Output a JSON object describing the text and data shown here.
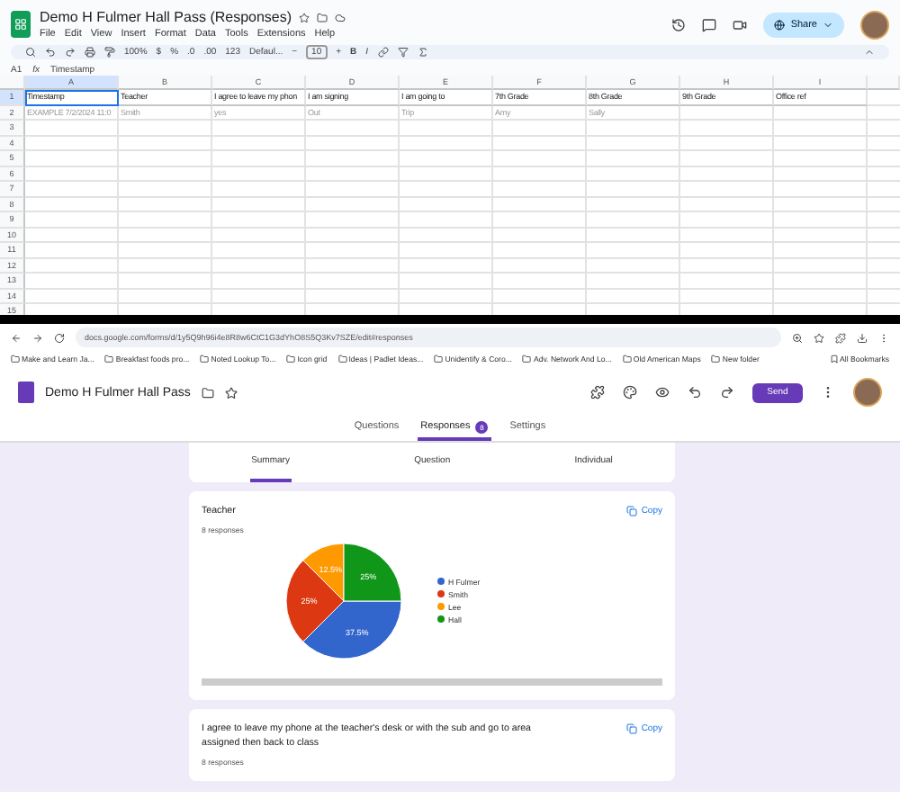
{
  "sheets": {
    "title": "Demo H Fulmer Hall Pass (Responses)",
    "menu": [
      "File",
      "Edit",
      "View",
      "Insert",
      "Format",
      "Data",
      "Tools",
      "Extensions",
      "Help"
    ],
    "share": "Share",
    "toolbar": {
      "zoom": "100%",
      "currency": "$",
      "percent": "%",
      "dec_less": ".0",
      "dec_more": ".00",
      "number_format": "123",
      "font": "Defaul...",
      "minus": "−",
      "font_size": "10",
      "plus": "+",
      "bold": "B",
      "italic": "I"
    },
    "name_box": "A1",
    "fx": "fx",
    "formula": "Timestamp",
    "columns": [
      {
        "label": "A",
        "selected": true
      },
      {
        "label": "B",
        "selected": false
      },
      {
        "label": "C",
        "selected": false
      },
      {
        "label": "D",
        "selected": false
      },
      {
        "label": "E",
        "selected": false
      },
      {
        "label": "F",
        "selected": false
      },
      {
        "label": "G",
        "selected": false
      },
      {
        "label": "H",
        "selected": false
      },
      {
        "label": "I",
        "selected": false
      }
    ],
    "rows": [
      {
        "num": "1",
        "selected": true,
        "cells": [
          "Timestamp",
          "Teacher",
          "I agree to leave my phon",
          "I am signing",
          "I am going to",
          "7th Grade",
          "8th Grade",
          "9th Grade",
          "Office ref"
        ]
      },
      {
        "num": "2",
        "selected": false,
        "cells": [
          "EXAMPLE  7/2/2024 11:0",
          "Smith",
          "yes",
          "Out",
          "Trip",
          "Amy",
          "Sally",
          "",
          ""
        ]
      },
      {
        "num": "3",
        "selected": false,
        "cells": []
      },
      {
        "num": "4",
        "selected": false,
        "cells": []
      },
      {
        "num": "5",
        "selected": false,
        "cells": []
      },
      {
        "num": "6",
        "selected": false,
        "cells": []
      },
      {
        "num": "7",
        "selected": false,
        "cells": []
      },
      {
        "num": "8",
        "selected": false,
        "cells": []
      },
      {
        "num": "9",
        "selected": false,
        "cells": []
      },
      {
        "num": "10",
        "selected": false,
        "cells": []
      },
      {
        "num": "11",
        "selected": false,
        "cells": []
      },
      {
        "num": "12",
        "selected": false,
        "cells": []
      },
      {
        "num": "13",
        "selected": false,
        "cells": []
      },
      {
        "num": "14",
        "selected": false,
        "cells": []
      },
      {
        "num": "15",
        "selected": false,
        "cells": []
      }
    ]
  },
  "browser": {
    "url": "docs.google.com/forms/d/1y5Q9h96i4e8R8w6CtC1G3dYhO8S5Q3Kv7SZE/edit#responses",
    "bookmarks": [
      "Make and Learn Ja...",
      "Breakfast foods pro...",
      "Noted Lookup To...",
      "Icon grid",
      "Ideas | Padlet Ideas...",
      "Unidentify & Coro...",
      "Adv. Network And Lo...",
      "Old American Maps",
      "New folder"
    ],
    "all_bookmarks": "All Bookmarks"
  },
  "form": {
    "title": "Demo H Fulmer Hall Pass",
    "send": "Send",
    "tabs": [
      {
        "label": "Questions",
        "selected": false
      },
      {
        "label": "Responses",
        "selected": true,
        "badge": "8"
      },
      {
        "label": "Settings",
        "selected": false
      }
    ],
    "subtabs": [
      {
        "label": "Summary",
        "selected": true
      },
      {
        "label": "Question",
        "selected": false
      },
      {
        "label": "Individual",
        "selected": false
      }
    ],
    "cards": [
      {
        "question": "Teacher",
        "count": "8 responses",
        "copy": "Copy",
        "chart_data": {
          "type": "pie",
          "categories": [
            "H Fulmer",
            "Smith",
            "Lee",
            "Hall"
          ],
          "series": [
            {
              "values": [
                37.5,
                25,
                12.5,
                25
              ]
            }
          ],
          "colors": [
            "#3366cc",
            "#dc3912",
            "#ff9900",
            "#109618"
          ],
          "value_labels": [
            "37.5%",
            "25%",
            "12.5%",
            "25%"
          ]
        }
      },
      {
        "question": "I agree to leave my phone at the teacher's desk or with the sub and go to area assigned then back to class",
        "count": "8 responses",
        "copy": "Copy"
      }
    ]
  }
}
